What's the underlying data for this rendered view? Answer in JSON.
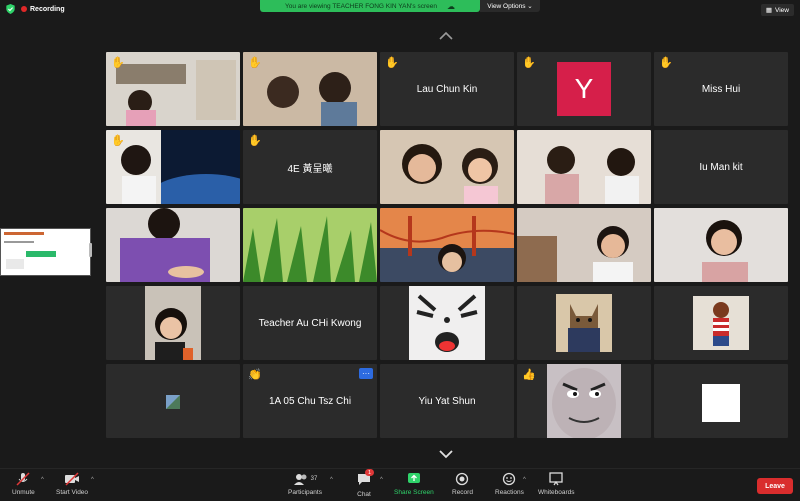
{
  "header": {
    "recording_label": "Recording",
    "viewing_banner": "You are viewing TEACHER FONG KIN YAN's screen",
    "view_options_label": "View Options ⌄",
    "view_label": "View"
  },
  "participants": [
    {
      "name": "",
      "hand": "✋",
      "video": true
    },
    {
      "name": "",
      "hand": "✋",
      "video": true
    },
    {
      "name": "Lau Chun Kin",
      "hand": "✋",
      "video": false
    },
    {
      "name": "",
      "hand": "✋",
      "video": false,
      "avatar_letter": "Y"
    },
    {
      "name": "Miss Hui",
      "hand": "✋",
      "video": false
    },
    {
      "name": "",
      "hand": "✋",
      "video": true
    },
    {
      "name": "4E 黃呈曦",
      "hand": "✋",
      "video": false
    },
    {
      "name": "",
      "hand": "",
      "video": true
    },
    {
      "name": "",
      "hand": "",
      "video": true
    },
    {
      "name": "Iu Man kit",
      "hand": "",
      "video": false
    },
    {
      "name": "",
      "hand": "",
      "video": true
    },
    {
      "name": "",
      "hand": "",
      "video": true
    },
    {
      "name": "",
      "hand": "",
      "video": true
    },
    {
      "name": "",
      "hand": "",
      "video": true
    },
    {
      "name": "",
      "hand": "",
      "video": true
    },
    {
      "name": "",
      "hand": "",
      "video": true
    },
    {
      "name": "Teacher Au CHi Kwong",
      "hand": "",
      "video": false
    },
    {
      "name": "",
      "hand": "",
      "video": true
    },
    {
      "name": "",
      "hand": "",
      "video": true
    },
    {
      "name": "",
      "hand": "",
      "video": true
    },
    {
      "name": "",
      "hand": "",
      "video": true
    },
    {
      "name": "1A 05 Chu Tsz Chi",
      "hand": "👏",
      "video": false
    },
    {
      "name": "Yiu Yat Shun",
      "hand": "",
      "video": false
    },
    {
      "name": "",
      "hand": "👍",
      "video": true
    },
    {
      "name": "",
      "hand": "",
      "video": true
    }
  ],
  "toolbar": {
    "unmute": "Unmute",
    "start_video": "Start Video",
    "participants": "Participants",
    "participants_count": "37",
    "chat": "Chat",
    "chat_badge": "1",
    "share_screen": "Share Screen",
    "record": "Record",
    "reactions": "Reactions",
    "whiteboards": "Whiteboards",
    "leave": "Leave"
  },
  "colors": {
    "accent_green": "#2dbd5a",
    "leave_red": "#d92d2d",
    "avatar_y": "#d61f4a"
  }
}
